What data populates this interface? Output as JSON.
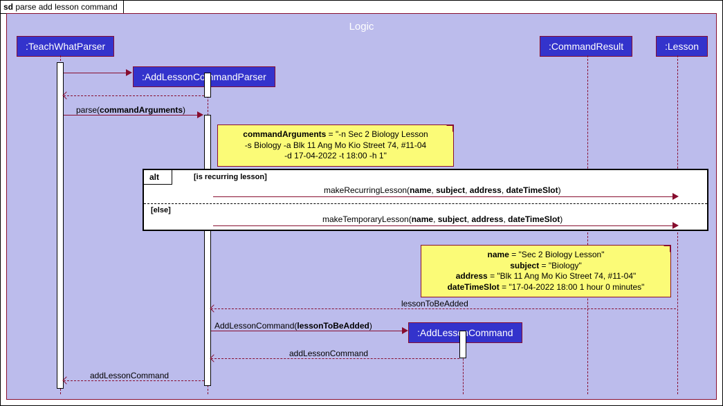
{
  "sd_label_prefix": "sd",
  "sd_title": "parse add lesson command",
  "frame_title": "Logic",
  "participants": {
    "p1": ":TeachWhatParser",
    "p2": ":AddLessonCommandParser",
    "p3": ":CommandResult",
    "p4": ":Lesson",
    "p5": ":AddLessonCommand"
  },
  "messages": {
    "m_parse": "parse(commandArguments)",
    "m_makeRecurring": "makeRecurringLesson(name, subject, address, dateTimeSlot)",
    "m_makeTemporary": "makeTemporaryLesson(name, subject, address, dateTimeSlot)",
    "m_return_lessonToBeAdded": "lessonToBeAdded",
    "m_create_addLessonCmd": "AddLessonCommand(lessonToBeAdded)",
    "m_return_addLessonCmd1": "addLessonCommand",
    "m_return_addLessonCmd2": "addLessonCommand"
  },
  "alt": {
    "label": "alt",
    "guard1": "[is recurring lesson]",
    "guard2": "[else]"
  },
  "note1": {
    "line1_k": "commandArguments",
    "line1_v": " = \"-n Sec 2 Biology Lesson",
    "line2": "-s Biology -a Blk 11 Ang Mo Kio Street 74, #11-04",
    "line3": "-d 17-04-2022 -t 18:00 -h 1\""
  },
  "note2": {
    "name_k": "name",
    "name_v": " = \"Sec 2 Biology Lesson\"",
    "subject_k": "subject",
    "subject_v": " = \"Biology\"",
    "address_k": "address",
    "address_v": " = \"Blk 11 Ang Mo Kio Street 74, #11-04\"",
    "dateTime_k": "dateTimeSlot",
    "dateTime_v": " = \"17-04-2022 18:00 1 hour 0 minutes\""
  }
}
